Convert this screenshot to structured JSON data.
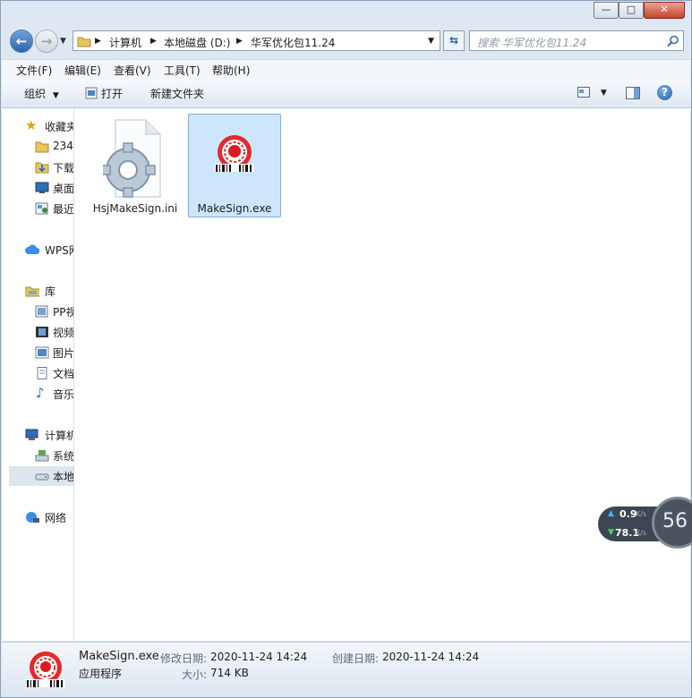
{
  "window": {
    "caption_buttons": {
      "minimize": "—",
      "maximize": "□",
      "close": "✕"
    }
  },
  "address_bar": {
    "crumbs": [
      "计算机",
      "本地磁盘 (D:)",
      "华军优化包11.24"
    ],
    "search_placeholder": "搜索 华军优化包11.24"
  },
  "menu": [
    "文件(F)",
    "编辑(E)",
    "查看(V)",
    "工具(T)",
    "帮助(H)"
  ],
  "toolbar": {
    "organize": "组织",
    "open": "打开",
    "new_folder": "新建文件夹"
  },
  "sidebar": {
    "favorites": {
      "label": "收藏夹",
      "items": [
        "234",
        "下载",
        "桌面",
        "最近访问的位置"
      ]
    },
    "wps": {
      "label": "WPS网盘"
    },
    "libraries": {
      "label": "库",
      "items": [
        "PP视频",
        "视频",
        "图片",
        "文档",
        "音乐"
      ]
    },
    "computer": {
      "label": "计算机",
      "items": [
        "系统",
        "本地磁盘 (D:)"
      ]
    },
    "network": {
      "label": "网络"
    }
  },
  "files": [
    {
      "name": "HsjMakeSign.ini",
      "icon": "settings-file-icon",
      "selected": false
    },
    {
      "name": "MakeSign.exe",
      "icon": "makesign-app-icon",
      "selected": true
    }
  ],
  "details_pane": {
    "file_name": "MakeSign.exe",
    "file_type": "应用程序",
    "modified_label": "修改日期:",
    "modified_value": "2020-11-24 14:24",
    "size_label": "大小:",
    "size_value": "714 KB",
    "created_label": "创建日期:",
    "created_value": "2020-11-24 14:24"
  },
  "net_widget": {
    "upload": "0.9",
    "upload_unit": "K/s",
    "download": "78.1",
    "download_unit": "K/s",
    "percent": "56"
  },
  "colors": {
    "accent": "#cde6fb",
    "title_bg": "#dfe8f2",
    "close": "#c4412b"
  }
}
